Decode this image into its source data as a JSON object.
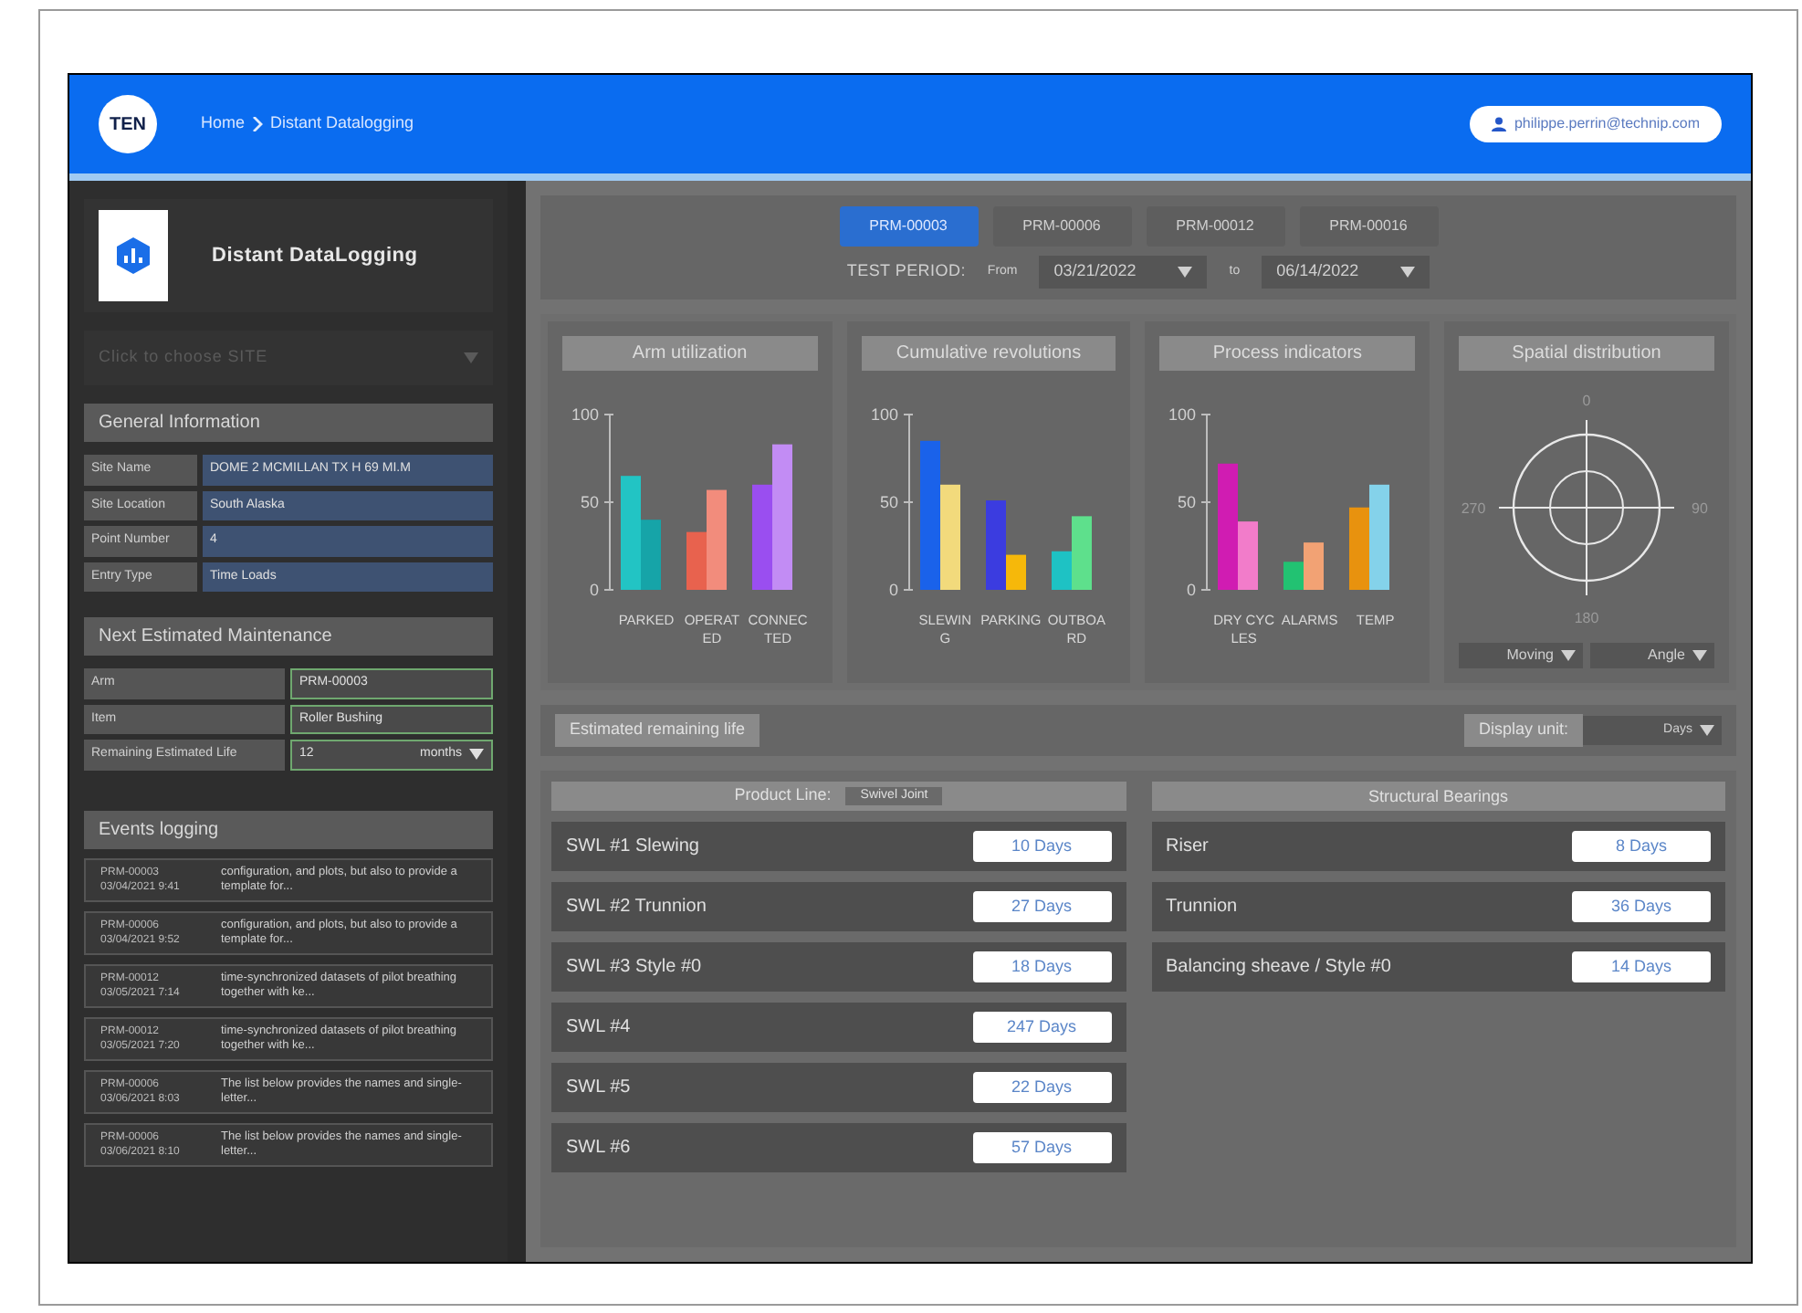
{
  "header": {
    "logo": "TEN",
    "breadcrumb": [
      "Home",
      "Distant Datalogging"
    ],
    "user": "philippe.perrin@technip.com"
  },
  "sidebar": {
    "app_title": "Distant DataLogging",
    "site_select": {
      "placeholder": "Click to choose SITE",
      "disabled": true
    },
    "general_information": {
      "title": "General Information",
      "fields": [
        {
          "label": "Site Name",
          "value": "DOME 2 MCMILLAN TX H 69 MI.M"
        },
        {
          "label": "Site Location",
          "value": "South Alaska"
        },
        {
          "label": "Point Number",
          "value": "4"
        },
        {
          "label": "Entry Type",
          "value": "Time Loads"
        }
      ]
    },
    "maintenance": {
      "title": "Next Estimated Maintenance",
      "fields": [
        {
          "label": "Arm",
          "value": "PRM-00003"
        },
        {
          "label": "Item",
          "value": "Roller Bushing"
        },
        {
          "label": "Remaining Estimated Life",
          "value": "12",
          "unit": "months"
        }
      ]
    },
    "events": {
      "title": "Events logging",
      "items": [
        {
          "id": "PRM-00003",
          "time": "03/04/2021 9:41",
          "text": "configuration, and plots, but also to provide a template for..."
        },
        {
          "id": "PRM-00006",
          "time": "03/04/2021 9:52",
          "text": "configuration, and plots, but also to provide a template for..."
        },
        {
          "id": "PRM-00012",
          "time": "03/05/2021 7:14",
          "text": "time-synchronized datasets of pilot breathing together with ke..."
        },
        {
          "id": "PRM-00012",
          "time": "03/05/2021 7:20",
          "text": "time-synchronized datasets of pilot breathing together with ke..."
        },
        {
          "id": "PRM-00006",
          "time": "03/06/2021 8:03",
          "text": "The list below provides the names and single-letter..."
        },
        {
          "id": "PRM-00006",
          "time": "03/06/2021 8:10",
          "text": "The list below provides the names and single-letter..."
        }
      ]
    }
  },
  "arm_tabs": [
    {
      "label": "PRM-00003",
      "selected": true
    },
    {
      "label": "PRM-00006",
      "selected": false
    },
    {
      "label": "PRM-00012",
      "selected": false
    },
    {
      "label": "PRM-00016",
      "selected": false
    }
  ],
  "test_period": {
    "label": "TEST PERIOD:",
    "from_label": "From",
    "from": "03/21/2022",
    "to_label": "to",
    "to": "06/14/2022"
  },
  "charts": [
    {
      "title": "Arm utilization",
      "chart_data": {
        "type": "bar",
        "categories": [
          "PARKED",
          "OPERATED",
          "CONNECTED"
        ],
        "ylim": [
          0,
          100
        ],
        "yticks": [
          0,
          50,
          100
        ],
        "series": [
          {
            "values": [
              65,
              33,
              60
            ],
            "colors": [
              "#22c4c4",
              "#e8624e",
              "#9a4ef0"
            ]
          },
          {
            "values": [
              40,
              57,
              83
            ],
            "colors": [
              "#16a4a8",
              "#f28c7c",
              "#c28cf4"
            ]
          }
        ]
      }
    },
    {
      "title": "Cumulative revolutions",
      "chart_data": {
        "type": "bar",
        "categories": [
          "SLEWING",
          "PARKING",
          "OUTBOARD"
        ],
        "ylim": [
          0,
          100
        ],
        "yticks": [
          0,
          50,
          100
        ],
        "series": [
          {
            "values": [
              85,
              51,
              22
            ],
            "colors": [
              "#1a62ea",
              "#3b3ce0",
              "#1ec2c4"
            ]
          },
          {
            "values": [
              60,
              20,
              42
            ],
            "colors": [
              "#f2da7c",
              "#f6b80a",
              "#5ee08c"
            ]
          }
        ]
      }
    },
    {
      "title": "Process indicators",
      "chart_data": {
        "type": "bar",
        "categories": [
          "DRY CYCLES",
          "ALARMS",
          "TEMP"
        ],
        "ylim": [
          0,
          100
        ],
        "yticks": [
          0,
          50,
          100
        ],
        "series": [
          {
            "values": [
              72,
              16,
              47
            ],
            "colors": [
              "#d01cb2",
              "#22c272",
              "#e8920e"
            ]
          },
          {
            "values": [
              39,
              27,
              60
            ],
            "colors": [
              "#f27cca",
              "#f2a274",
              "#84d2ea"
            ]
          }
        ]
      }
    }
  ],
  "spatial": {
    "title": "Spatial distribution",
    "angle_labels": [
      "0",
      "90",
      "180",
      "270"
    ],
    "selects": [
      "Moving",
      "Angle"
    ]
  },
  "remaining_life": {
    "title": "Estimated remaining life",
    "display_unit_label": "Display unit:",
    "display_unit": "Days",
    "product_line": {
      "label": "Product Line:",
      "value": "Swivel Joint",
      "rows": [
        {
          "name": "SWL #1 Slewing",
          "value": "10 Days"
        },
        {
          "name": "SWL #2 Trunnion",
          "value": "27 Days"
        },
        {
          "name": "SWL #3 Style #0",
          "value": "18 Days"
        },
        {
          "name": "SWL #4",
          "value": "247 Days"
        },
        {
          "name": "SWL #5",
          "value": "22 Days"
        },
        {
          "name": "SWL #6",
          "value": "57 Days"
        }
      ]
    },
    "structural_bearings": {
      "title": "Structural Bearings",
      "rows": [
        {
          "name": "Riser",
          "value": "8 Days"
        },
        {
          "name": "Trunnion",
          "value": "36 Days"
        },
        {
          "name": "Balancing sheave / Style #0",
          "value": "14 Days"
        }
      ]
    }
  }
}
